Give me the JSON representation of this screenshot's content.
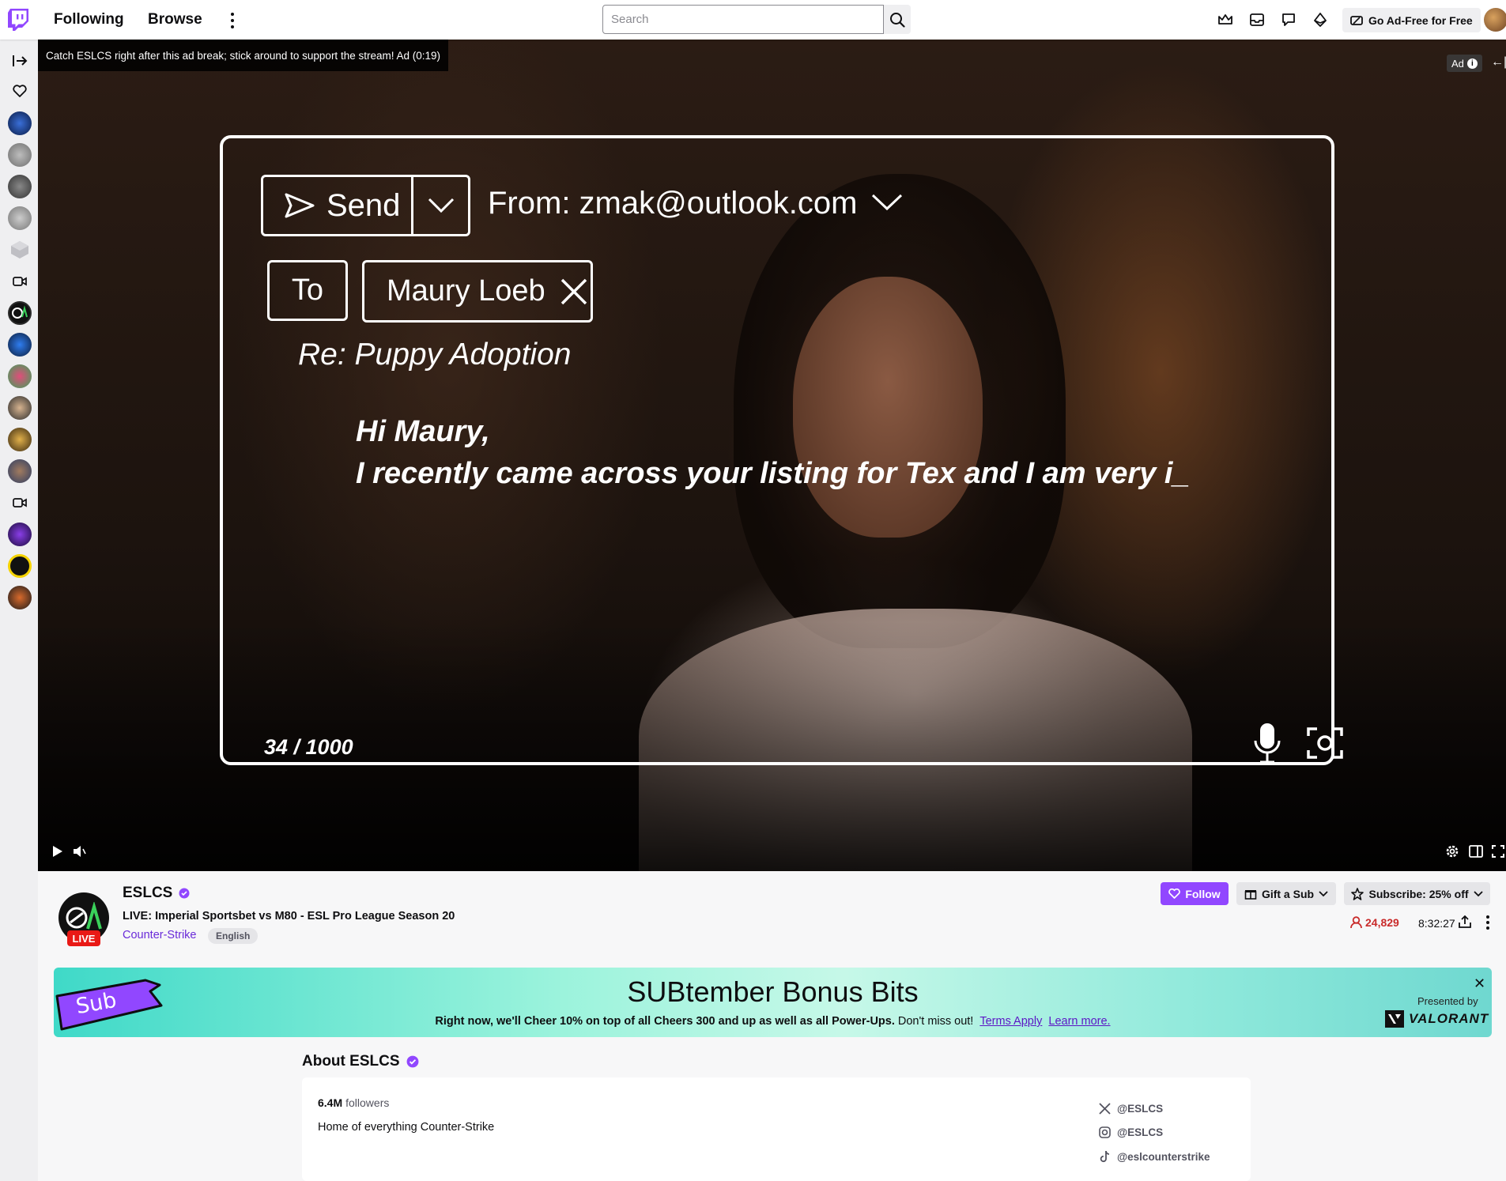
{
  "topnav": {
    "following": "Following",
    "browse": "Browse",
    "search_placeholder": "Search",
    "adfree_label": "Go Ad-Free for Free"
  },
  "player": {
    "ad_message": "Catch ESLCS right after this ad break; stick around to support the stream! Ad (0:19)",
    "ad_badge": "Ad",
    "email": {
      "send_label": "Send",
      "from_line": "From: zmak@outlook.com",
      "to_label": "To",
      "recipient": "Maury Loeb",
      "subject": "Re: Puppy Adoption",
      "greeting": "Hi Maury,",
      "body": "I recently came across your listing for Tex and I am very i_",
      "counter": "34   / 1000"
    }
  },
  "channel": {
    "name": "ESLCS",
    "live": "LIVE",
    "title": "LIVE: Imperial Sportsbet vs M80 - ESL Pro League Season 20",
    "game": "Counter-Strike",
    "language": "English",
    "follow_label": "Follow",
    "gift_label": "Gift a Sub",
    "subscribe_label": "Subscribe: 25% off",
    "viewers": "24,829",
    "uptime": "8:32:27"
  },
  "banner": {
    "sticker_text": "Sub",
    "title": "SUBtember Bonus Bits",
    "text_bold": "Right now, we'll Cheer 10% on top of all Cheers 300 and up as well as all Power-Ups.",
    "text_rest": " Don't miss out!",
    "terms_link": "Terms Apply",
    "learn_link": "Learn more.",
    "presented_by": "Presented by",
    "sponsor": "VALORANT"
  },
  "about": {
    "title": "About ESLCS",
    "followers_count": "6.4M",
    "followers_label": "followers",
    "description": "Home of everything Counter-Strike",
    "socials": [
      "@ESLCS",
      "@ESLCS",
      "@eslcounterstrike"
    ]
  },
  "colors": {
    "brand": "#9147ff",
    "live": "#e91916",
    "link": "#5c16c5"
  }
}
